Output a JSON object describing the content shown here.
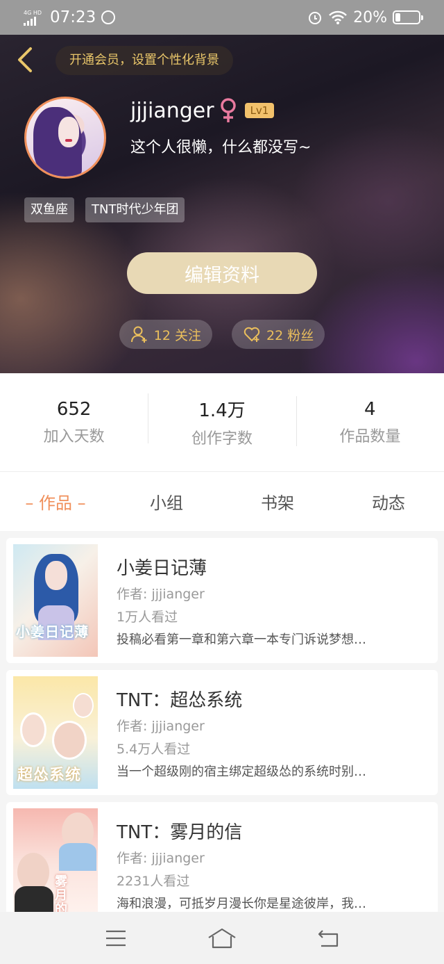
{
  "status_bar": {
    "network": "4G HD",
    "time": "07:23",
    "battery": "20%",
    "battery_level": 0.2
  },
  "header": {
    "vip_banner": "开通会员，设置个性化背景",
    "username": "jjjianger",
    "level": "Lv1",
    "bio": "这个人很懒，什么都没写~",
    "tags": [
      "双鱼座",
      "TNT时代少年团"
    ],
    "edit_button": "编辑资料",
    "following": "12 关注",
    "followers": "22 粉丝",
    "colors": {
      "accent": "#f08f5a",
      "gold": "#ebbf5c",
      "edit_button_bg": "#e8d9b5"
    }
  },
  "stats": [
    {
      "value": "652",
      "label": "加入天数"
    },
    {
      "value": "1.4万",
      "label": "创作字数"
    },
    {
      "value": "4",
      "label": "作品数量"
    }
  ],
  "tabs": [
    {
      "label": "– 作品 –",
      "active": true
    },
    {
      "label": "小组",
      "active": false
    },
    {
      "label": "书架",
      "active": false
    },
    {
      "label": "动态",
      "active": false
    }
  ],
  "books": [
    {
      "title": "小姜日记薄",
      "author": "作者: jjjianger",
      "views": "1万人看过",
      "desc": "投稿必看第一章和第六章一本专门诉说梦想…",
      "cover_text": "小姜日记薄"
    },
    {
      "title": "TNT：超怂系统",
      "author": "作者: jjjianger",
      "views": "5.4万人看过",
      "desc": "当一个超级刚的宿主绑定超级怂的系统时别…",
      "cover_text": "超怂系统"
    },
    {
      "title": "TNT：雾月的信",
      "author": "作者: jjjianger",
      "views": "2231人看过",
      "desc": "海和浪漫，可抵岁月漫长你是星途彼岸，我…",
      "cover_text": "雾月的信"
    }
  ],
  "nav": {
    "icons": [
      "menu-icon",
      "home-icon",
      "back-icon"
    ]
  }
}
